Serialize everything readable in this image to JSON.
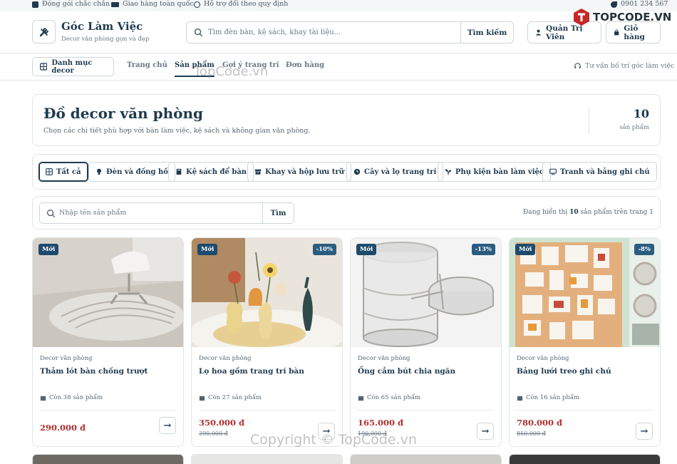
{
  "topbar": {
    "items": [
      "Đóng gói chắc chắn",
      "Giao hàng toàn quốc",
      "Hỗ trợ đổi theo quy định"
    ],
    "phone": "0901 234 567"
  },
  "header": {
    "brand": "Góc Làm Việc",
    "tagline": "Decor văn phòng gọn và đẹp",
    "search_placeholder": "Tìm đèn bàn, kệ sách, khay tài liệu...",
    "search_button": "Tìm kiếm",
    "admin_button": "Quản Trị Viên",
    "cart_button": "Giỏ hàng"
  },
  "nav": {
    "category_button": "Danh mục decor",
    "links": [
      "Trang chủ",
      "Sản phẩm",
      "Gợi ý trang trí",
      "Đơn hàng"
    ],
    "active_index": 1,
    "advice": "Tư vấn bố trí góc làm việc"
  },
  "hero": {
    "title": "Đồ decor văn phòng",
    "subtitle": "Chọn các chi tiết phù hợp với bàn làm việc, kệ sách và không gian văn phòng.",
    "count": "10",
    "count_label": "sản phẩm"
  },
  "filters": [
    {
      "label": "Tất cả",
      "icon": "grid-icon"
    },
    {
      "label": "Đèn và đồng hồ",
      "icon": "bulb-icon"
    },
    {
      "label": "Kệ sách để bàn",
      "icon": "book-icon"
    },
    {
      "label": "Khay và hộp lưu trữ",
      "icon": "box-icon"
    },
    {
      "label": "Cây và lọ trang trí",
      "icon": "clock-icon"
    },
    {
      "label": "Phụ kiện bàn làm việc",
      "icon": "sprout-icon"
    },
    {
      "label": "Tranh và bảng ghi chú",
      "icon": "monitor-icon"
    }
  ],
  "product_search": {
    "placeholder": "Nhập tên sản phẩm",
    "button": "Tìm",
    "showing_pre": "Đang hiển thị",
    "showing_count": "10",
    "showing_post": "sản phẩm trên trang 1"
  },
  "products": [
    {
      "badge": "Mới",
      "discount": "",
      "category": "Decor văn phòng",
      "name": "Thảm lót bàn chống trượt",
      "stock": "Còn 38 sản phẩm",
      "price": "290.000 đ",
      "old_price": ""
    },
    {
      "badge": "Mới",
      "discount": "-10%",
      "category": "Decor văn phòng",
      "name": "Lọ hoa gốm trang trí bàn",
      "stock": "Còn 27 sản phẩm",
      "price": "350.000 đ",
      "old_price": "390.000 đ"
    },
    {
      "badge": "Mới",
      "discount": "-13%",
      "category": "Decor văn phòng",
      "name": "Ống cắm bút chia ngăn",
      "stock": "Còn 65 sản phẩm",
      "price": "165.000 đ",
      "old_price": "190.000 đ"
    },
    {
      "badge": "Mới",
      "discount": "-8%",
      "category": "Decor văn phòng",
      "name": "Bảng lưới treo ghi chú",
      "stock": "Còn 16 sản phẩm",
      "price": "780.000 đ",
      "old_price": "850.000 đ"
    }
  ],
  "watermarks": {
    "top": "TopCode.vn",
    "bottom": "Copyright © TopCode.vn",
    "logo": "TOPCODE.VN"
  },
  "colors": {
    "primary": "#1e3a4f",
    "badge": "#1e4a6b",
    "price": "#b42f2f"
  }
}
